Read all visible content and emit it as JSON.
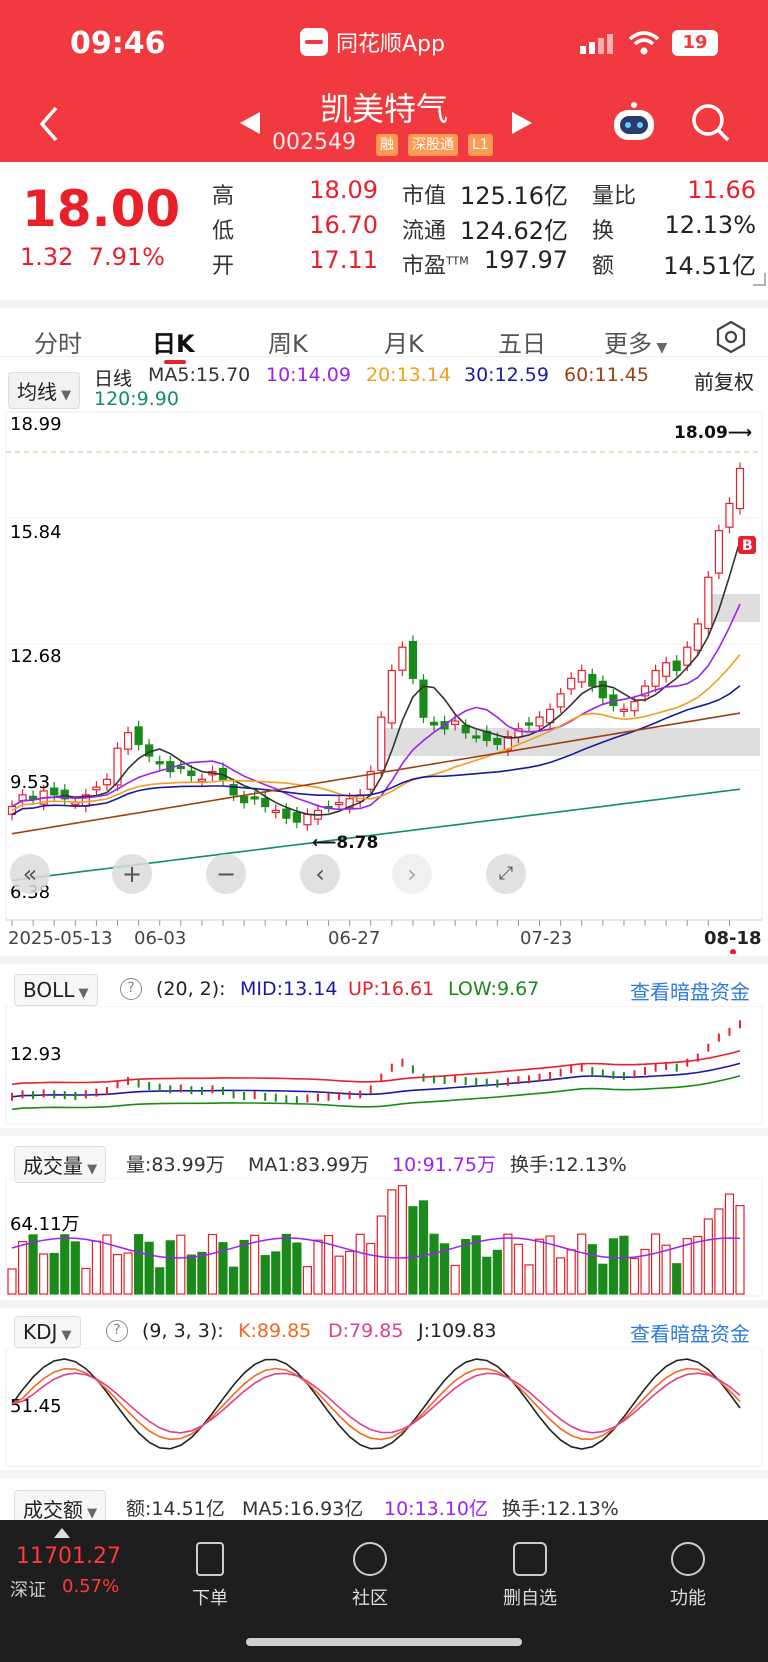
{
  "status": {
    "time": "09:46",
    "app": "同花顺App",
    "battery": "19"
  },
  "stock": {
    "name": "凯美特气",
    "code": "002549",
    "tags": [
      "融",
      "深股通",
      "L1"
    ]
  },
  "quote": {
    "price": "18.00",
    "change": "1.32",
    "change_pct": "7.91%",
    "high_label": "高",
    "high": "18.09",
    "low_label": "低",
    "low": "16.70",
    "open_label": "开",
    "open": "17.11",
    "mcap_label": "市值",
    "mcap": "125.16亿",
    "float_label": "流通",
    "float": "124.62亿",
    "pe_label": "市盈",
    "pe_sup": "TTM",
    "pe": "197.97",
    "vr_label": "量比",
    "vr": "11.66",
    "turn_label": "换",
    "turn": "12.13%",
    "amt_label": "额",
    "amt": "14.51亿"
  },
  "tabs": [
    "分时",
    "日K",
    "周K",
    "月K",
    "五日",
    "更多"
  ],
  "ma": {
    "selector": "均线",
    "line": "日线",
    "ma5": "MA5:15.70",
    "ma10": "10:14.09",
    "ma20": "20:13.14",
    "ma30": "30:12.59",
    "ma60": "60:11.45",
    "ma120": "120:9.90",
    "adjust": "前复权"
  },
  "kline": {
    "price_labels": [
      "18.99",
      "15.84",
      "12.68",
      "9.53",
      "6.38"
    ],
    "high_mark": "18.09",
    "low_mark": "8.78",
    "dates": [
      "2025-05-13",
      "06-03",
      "06-27",
      "07-23",
      "08-18"
    ]
  },
  "boll": {
    "name": "BOLL",
    "params": "(20, 2):",
    "mid": "MID:13.14",
    "up": "UP:16.61",
    "low": "LOW:9.67",
    "axis": "12.93",
    "link": "查看暗盘资金"
  },
  "volume": {
    "name": "成交量",
    "v": "量:83.99万",
    "ma1": "MA1:83.99万",
    "ma10": "10:91.75万",
    "turn": "换手:12.13%",
    "axis": "64.11万"
  },
  "kdj": {
    "name": "KDJ",
    "params": "(9, 3, 3):",
    "k": "K:89.85",
    "d": "D:79.85",
    "j": "J:109.83",
    "axis": "51.45",
    "link": "查看暗盘资金"
  },
  "amount": {
    "name": "成交额",
    "v": "额:14.51亿",
    "ma5": "MA5:16.93亿",
    "ma10": "10:13.10亿",
    "turn": "换手:12.13%"
  },
  "bottom": {
    "index_value": "11701.27",
    "index_name": "深证",
    "index_pct": "0.57%",
    "items": [
      "下单",
      "社区",
      "删自选",
      "功能"
    ]
  },
  "colors": {
    "up": "#e8202a",
    "down": "#1a8a1a",
    "ma5": "#333333",
    "ma10": "#a020f0",
    "ma20": "#f0a020",
    "ma30": "#1a1aa0",
    "ma60": "#a04010",
    "ma120": "#109060"
  }
}
